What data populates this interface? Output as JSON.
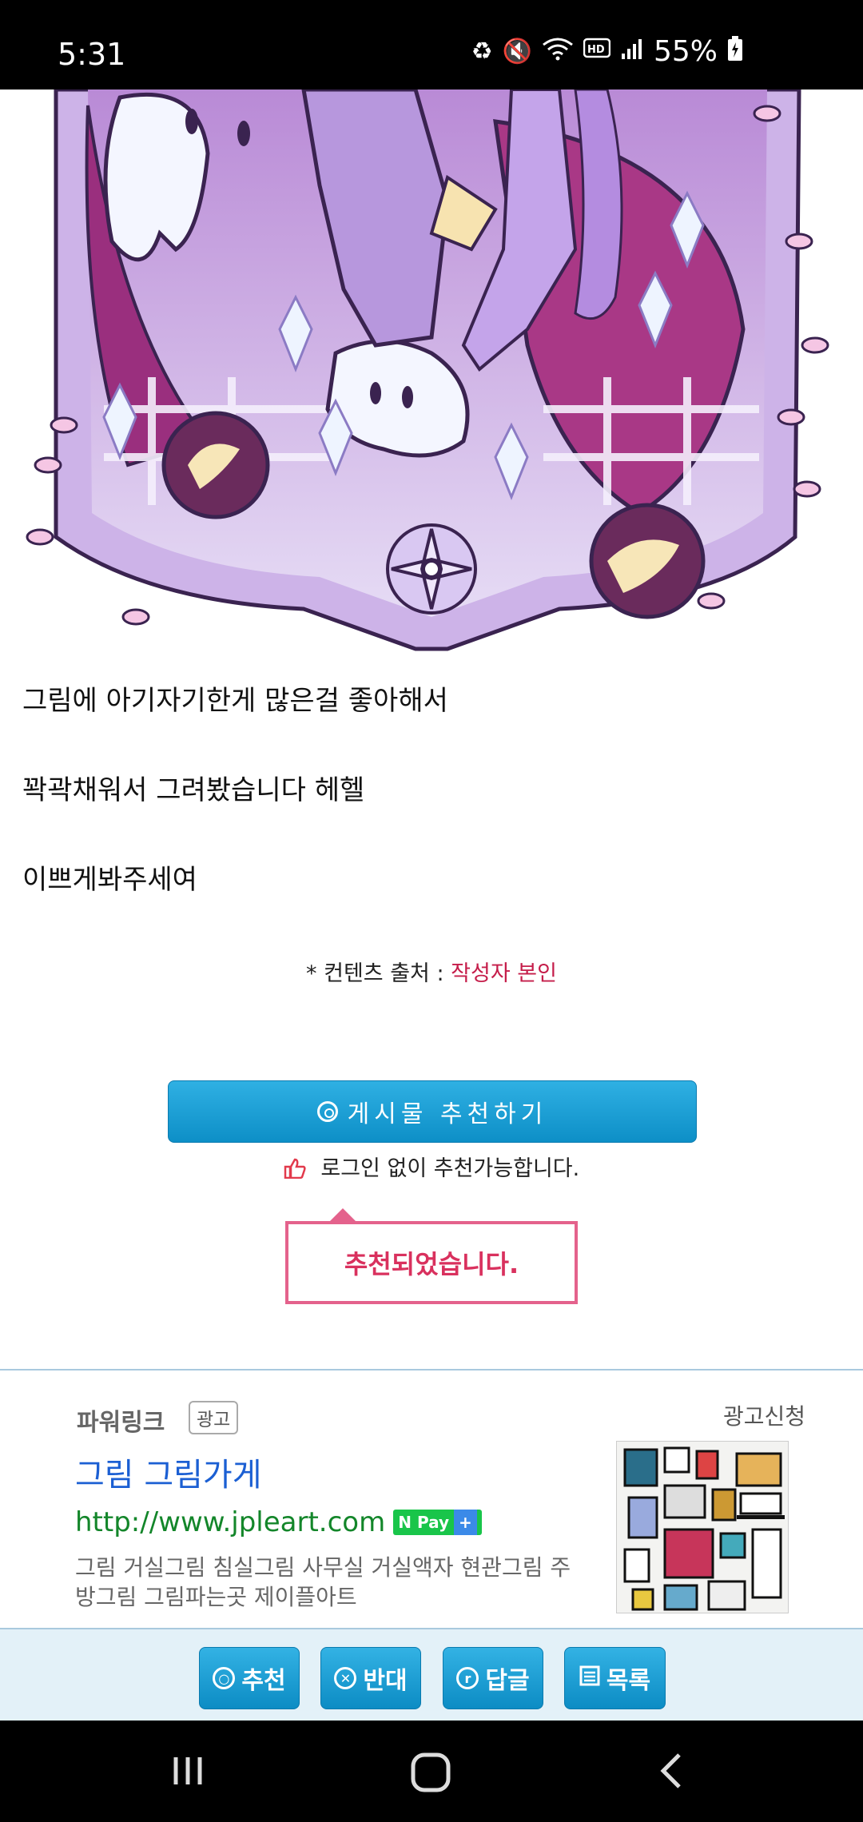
{
  "status_bar": {
    "time": "5:31",
    "battery": "55%",
    "icons": [
      "battery-saver-icon",
      "mute-icon",
      "wifi-icon",
      "hd-voice-icon",
      "signal-icon",
      "battery-charging-icon"
    ]
  },
  "post": {
    "lines": [
      "그림에 아기자기한게 많은걸 좋아해서",
      "꽉곽채워서 그려봤습니다 헤헬",
      "이쁘게봐주세여"
    ],
    "source_label": "* 컨텐츠 출처 : ",
    "source_value": "작성자 본인"
  },
  "recommend": {
    "button_label": "게시물  추천하기",
    "no_login_text": "로그인 없이 추천가능합니다.",
    "done_message": "추천되었습니다."
  },
  "ad": {
    "brand": "파워링크",
    "tag": "광고",
    "apply": "광고신청",
    "title": "그림 그림가게",
    "url": "http://www.jpleart.com",
    "npay": "Pay",
    "npay_n": "N",
    "npay_plus": "+",
    "desc": "그림 거실그림 침실그림 사무실 거실액자 현관그림 주방그림 그림파는곳 제이플아트"
  },
  "bottom_actions": {
    "recommend": "추천",
    "oppose": "반대",
    "reply": "답글",
    "list": "목록"
  },
  "colors": {
    "accent_blue": "#0d8fc7",
    "alert_pink": "#e4628c",
    "ad_title": "#1b5fd3",
    "ad_url": "#13862a"
  }
}
